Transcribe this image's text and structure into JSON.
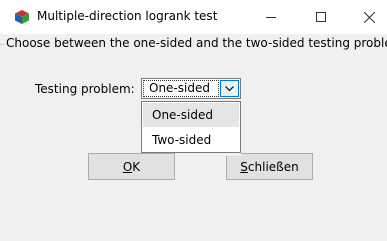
{
  "window": {
    "title": "Multiple-direction logrank test",
    "controls": {
      "minimize": "minimize-icon",
      "maximize": "maximize-icon",
      "close": "close-icon"
    }
  },
  "instruction": "Choose between the one-sided and the two-sided testing problem",
  "testing_problem": {
    "label": "Testing problem:",
    "selected": "One-sided",
    "options": [
      "One-sided",
      "Two-sided"
    ],
    "highlighted_option": "One-sided"
  },
  "buttons": {
    "ok": "OK",
    "close": "Schließen"
  },
  "colors": {
    "accent": "#0078d7",
    "window_bg": "#f0f0f0",
    "highlight": "#e5e5e5"
  }
}
